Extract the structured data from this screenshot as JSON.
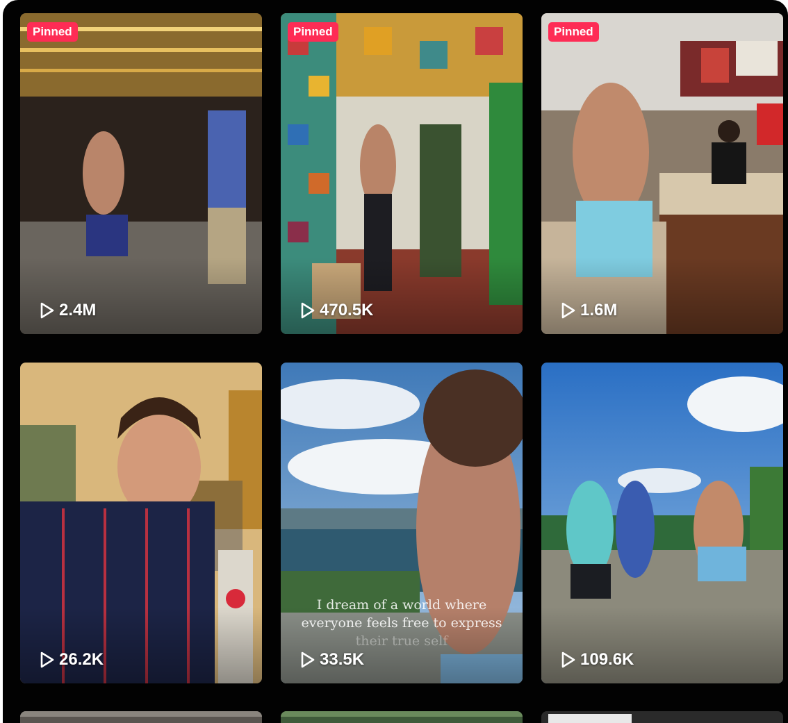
{
  "videos": [
    {
      "pinned_label": "Pinned",
      "views": "2.4M",
      "icon": "play-icon"
    },
    {
      "pinned_label": "Pinned",
      "views": "470.5K",
      "icon": "play-icon"
    },
    {
      "pinned_label": "Pinned",
      "views": "1.6M",
      "icon": "play-icon"
    },
    {
      "views": "26.2K",
      "icon": "play-icon"
    },
    {
      "views": "33.5K",
      "icon": "play-icon",
      "caption_lines": [
        "I dream of a world where",
        "everyone feels free to express",
        "their true self"
      ]
    },
    {
      "views": "109.6K",
      "icon": "play-icon"
    }
  ],
  "colors": {
    "pinned_badge": "#fe2c55",
    "background": "#020202",
    "text": "#ffffff"
  }
}
